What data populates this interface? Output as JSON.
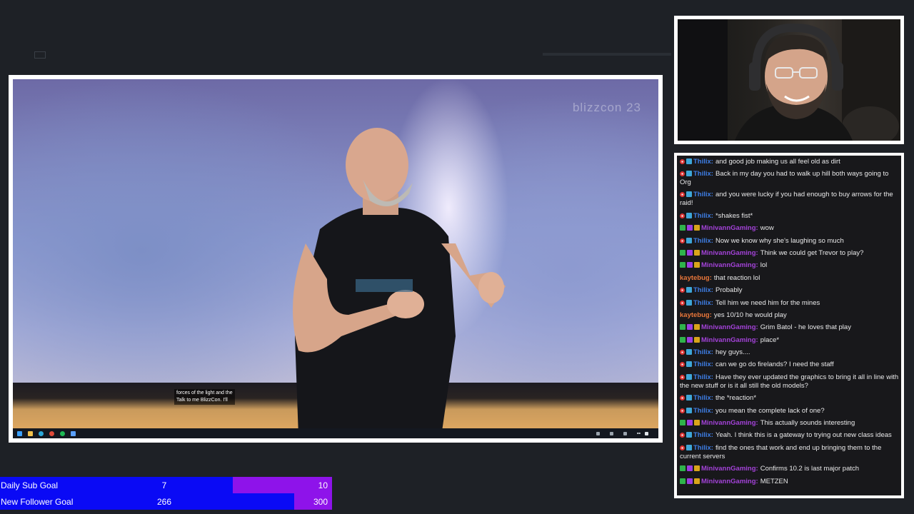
{
  "video": {
    "watermark": "blizzcon 23",
    "caption_line1": "forces of the light and the",
    "caption_line2": "Talk to me BlizzCon. I'll"
  },
  "chat": {
    "messages": [
      {
        "user": "Thilix",
        "color": "#3e7ee6",
        "badges": [
          "red",
          "blue"
        ],
        "text": "and good job making us all feel old as dirt"
      },
      {
        "user": "Thilix",
        "color": "#3e7ee6",
        "badges": [
          "red",
          "blue"
        ],
        "text": "Back in my day you had to walk up hill both ways going to Org"
      },
      {
        "user": "Thilix",
        "color": "#3e7ee6",
        "badges": [
          "red",
          "blue"
        ],
        "text": "and you were lucky if you had enough to buy arrows for the raid!"
      },
      {
        "user": "Thilix",
        "color": "#3e7ee6",
        "badges": [
          "red",
          "blue"
        ],
        "text": "*shakes fist*"
      },
      {
        "user": "MinivannGaming",
        "color": "#a342d8",
        "badges": [
          "green",
          "purple",
          "gold"
        ],
        "text": "wow"
      },
      {
        "user": "Thilix",
        "color": "#3e7ee6",
        "badges": [
          "red",
          "blue"
        ],
        "text": "Now we know why she's laughing so much"
      },
      {
        "user": "MinivannGaming",
        "color": "#a342d8",
        "badges": [
          "green",
          "purple",
          "gold"
        ],
        "text": "Think we could get Trevor to play?"
      },
      {
        "user": "MinivannGaming",
        "color": "#a342d8",
        "badges": [
          "green",
          "purple",
          "gold"
        ],
        "text": "lol"
      },
      {
        "user": "kaytebug",
        "color": "#e8763a",
        "badges": [],
        "text": "that reaction lol"
      },
      {
        "user": "Thilix",
        "color": "#3e7ee6",
        "badges": [
          "red",
          "blue"
        ],
        "text": "Probably"
      },
      {
        "user": "Thilix",
        "color": "#3e7ee6",
        "badges": [
          "red",
          "blue"
        ],
        "text": "Tell him we need him for the mines"
      },
      {
        "user": "kaytebug",
        "color": "#e8763a",
        "badges": [],
        "text": "yes 10/10 he would play"
      },
      {
        "user": "MinivannGaming",
        "color": "#a342d8",
        "badges": [
          "green",
          "purple",
          "gold"
        ],
        "text": "Grim Batol - he loves that play"
      },
      {
        "user": "MinivannGaming",
        "color": "#a342d8",
        "badges": [
          "green",
          "purple",
          "gold"
        ],
        "text": "place*"
      },
      {
        "user": "Thilix",
        "color": "#3e7ee6",
        "badges": [
          "red",
          "blue"
        ],
        "text": "hey guys...."
      },
      {
        "user": "Thilix",
        "color": "#3e7ee6",
        "badges": [
          "red",
          "blue"
        ],
        "text": "can we go do firelands? I need the staff"
      },
      {
        "user": "Thilix",
        "color": "#3e7ee6",
        "badges": [
          "red",
          "blue"
        ],
        "text": "Have they ever updated the graphics to bring it all in line with the new stuff or is it all still the old models?"
      },
      {
        "user": "Thilix",
        "color": "#3e7ee6",
        "badges": [
          "red",
          "blue"
        ],
        "text": "the *reaction*"
      },
      {
        "user": "Thilix",
        "color": "#3e7ee6",
        "badges": [
          "red",
          "blue"
        ],
        "text": "you mean the complete lack of one?"
      },
      {
        "user": "MinivannGaming",
        "color": "#a342d8",
        "badges": [
          "green",
          "purple",
          "gold"
        ],
        "text": "This actually sounds interesting"
      },
      {
        "user": "Thilix",
        "color": "#3e7ee6",
        "badges": [
          "red",
          "blue"
        ],
        "text": "Yeah. I think this is a gateway to trying out new class ideas"
      },
      {
        "user": "Thilix",
        "color": "#3e7ee6",
        "badges": [
          "red",
          "blue"
        ],
        "text": "find the ones that work and end up bringing them to the current servers"
      },
      {
        "user": "MinivannGaming",
        "color": "#a342d8",
        "badges": [
          "green",
          "purple",
          "gold"
        ],
        "text": "Confirms 10.2 is last major patch"
      },
      {
        "user": "MinivannGaming",
        "color": "#a342d8",
        "badges": [
          "green",
          "purple",
          "gold"
        ],
        "text": "METZEN"
      }
    ]
  },
  "goals": {
    "sub": {
      "label": "Daily Sub Goal",
      "current": "7",
      "target": "10",
      "progress": 0.7
    },
    "follower": {
      "label": "New Follower Goal",
      "current": "266",
      "target": "300",
      "progress": 0.887
    }
  },
  "colors": {
    "goal_fill": "#0a0af5",
    "goal_track": "#8e13ea",
    "frame_border": "#ffffff",
    "background": "#1e2126"
  }
}
